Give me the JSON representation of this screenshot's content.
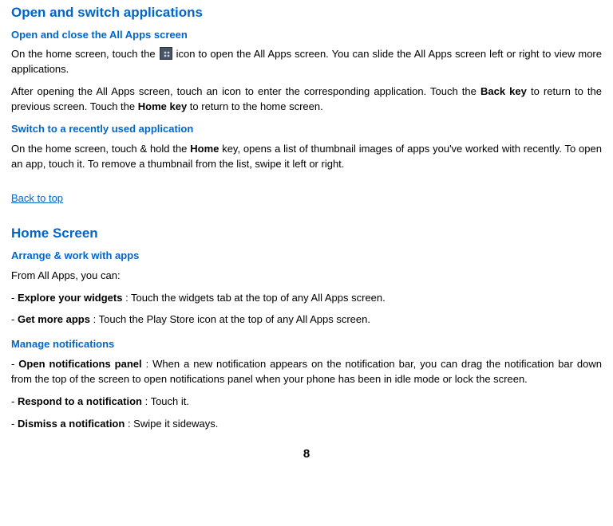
{
  "section1": {
    "title": "Open and switch applications",
    "sub1": {
      "title": "Open and close the All Apps screen",
      "p1a": "On the home screen, touch the ",
      "p1b": " icon to open the All Apps screen. You can slide the All Apps screen left or right to view more applications.",
      "p2a": "After opening the All Apps screen, touch an icon to enter the corresponding application. Touch the ",
      "p2bold1": "Back key",
      "p2b": " to return to the previous screen. Touch the ",
      "p2bold2": "Home key",
      "p2c": " to return to the home screen."
    },
    "sub2": {
      "title": "Switch to a recently used application",
      "p1a": "On the home screen, touch & hold the ",
      "p1bold": "Home",
      "p1b": " key, opens a list of thumbnail images of apps you've worked with recently. To open an app, touch it. To remove a thumbnail from the list, swipe it left or right."
    }
  },
  "backToTop": "Back to top",
  "section2": {
    "title": "Home Screen",
    "sub1": {
      "title": "Arrange & work with apps",
      "p1": "From All Apps, you can:",
      "li1bold": "Explore your widgets",
      "li1": ": Touch the widgets tab at the top of any All Apps screen.",
      "li2bold": "Get more apps",
      "li2": ": Touch the Play Store icon at the top of any All Apps screen."
    },
    "sub2": {
      "title": "Manage notifications",
      "li1bold": "Open notifications panel",
      "li1": ": When a new notification appears on the notification bar, you can drag the notification bar down from the top of the screen to open notifications panel when your phone has been in idle mode or lock the screen.",
      "li2bold": "Respond to a notification",
      "li2": ": Touch it.",
      "li3bold": "Dismiss a notification",
      "li3": ": Swipe it sideways."
    }
  },
  "pageNumber": "8"
}
